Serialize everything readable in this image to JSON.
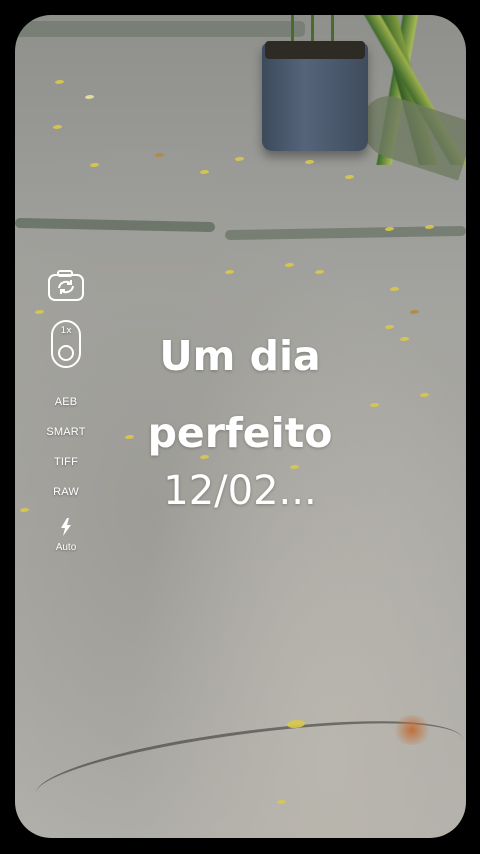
{
  "camera": {
    "zoom_label": "1x",
    "modes": [
      "AEB",
      "SMART",
      "TIFF",
      "RAW"
    ],
    "flash_label": "Auto",
    "icons": {
      "switch": "camera-switch-icon",
      "flash": "flash-icon"
    }
  },
  "overlay": {
    "title": "Um dia perfeito",
    "date": "12/02..."
  }
}
